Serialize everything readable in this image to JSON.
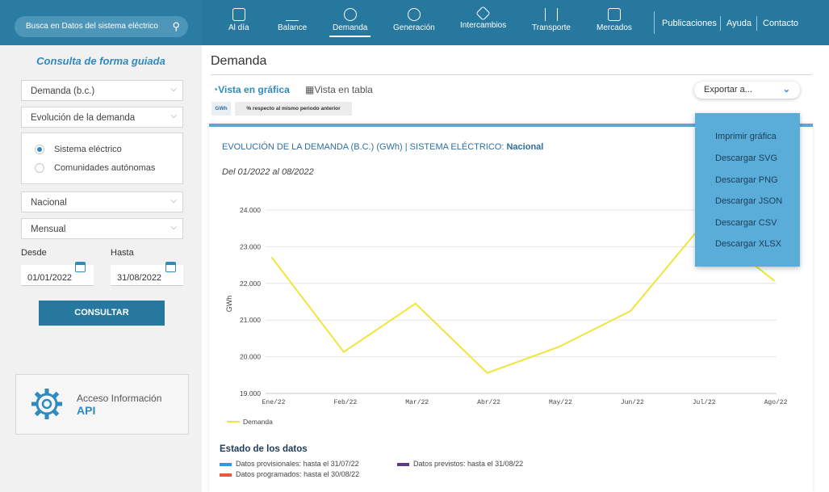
{
  "topbar": {
    "search_placeholder": "Busca en Datos del sistema eléctrico",
    "nav": [
      {
        "label": "Al día"
      },
      {
        "label": "Balance"
      },
      {
        "label": "Demanda"
      },
      {
        "label": "Generación"
      },
      {
        "label": "Intercambios"
      },
      {
        "label": "Transporte"
      },
      {
        "label": "Mercados"
      }
    ],
    "active_nav": "Demanda",
    "links": [
      "Publicaciones",
      "Ayuda",
      "Contacto"
    ]
  },
  "sidebar": {
    "title": "Consulta de forma guiada",
    "select_measure": "Demanda (b.c.)",
    "select_view": "Evolución de la demanda",
    "radio_options": [
      "Sistema eléctrico",
      "Comunidades autónomas"
    ],
    "radio_selected": "Sistema eléctrico",
    "select_region": "Nacional",
    "select_period": "Mensual",
    "from_label": "Desde",
    "to_label": "Hasta",
    "from_date": "01/01/2022",
    "to_date": "31/08/2022",
    "consult_button": "CONSULTAR",
    "api_line1": "Acceso Información",
    "api_line2": "API"
  },
  "main": {
    "page_title": "Demanda",
    "tab_graph": "Vista en gráfica",
    "tab_table": "Vista en tabla",
    "tag_unit": "GWh",
    "tag_compare": "% respecto al mismo periodo anterior",
    "export_label": "Exportar a...",
    "export_menu": [
      "Imprimir gráfica",
      "Descargar SVG",
      "Descargar PNG",
      "Descargar JSON",
      "Descargar CSV",
      "Descargar XLSX"
    ],
    "chart_title_main": "EVOLUCIÓN DE LA DEMANDA (B.C.) (GWh) | SISTEMA ELÉCTRICO:",
    "chart_title_region": "Nacional",
    "chart_subtitle": "Del 01/2022 al 08/2022",
    "estado_title": "Estado de los datos",
    "estado": [
      {
        "label": "Datos provisionales:",
        "value": "hasta el 31/07/22",
        "color": "#2f9ad8"
      },
      {
        "label": "Datos previstos:",
        "value": "hasta el 31/08/22",
        "color": "#5a3a8a"
      },
      {
        "label": "Datos programados:",
        "value": "hasta el 30/08/22",
        "color": "#e85a3c"
      }
    ]
  },
  "chart_data": {
    "type": "line",
    "categories": [
      "Ene/22",
      "Feb/22",
      "Mar/22",
      "Abr/22",
      "May/22",
      "Jun/22",
      "Jul/22",
      "Ago/22"
    ],
    "series": [
      {
        "name": "Demanda",
        "values": [
          22700,
          20130,
          21450,
          19560,
          20270,
          21250,
          23600,
          22080
        ],
        "color": "#f2e43b"
      }
    ],
    "ylabel": "GWh",
    "ylim": [
      19000,
      24000
    ],
    "yticks": [
      "19.000",
      "20.000",
      "21.000",
      "22.000",
      "23.000",
      "24.000"
    ],
    "grid": true,
    "legend": "bottom-left"
  }
}
